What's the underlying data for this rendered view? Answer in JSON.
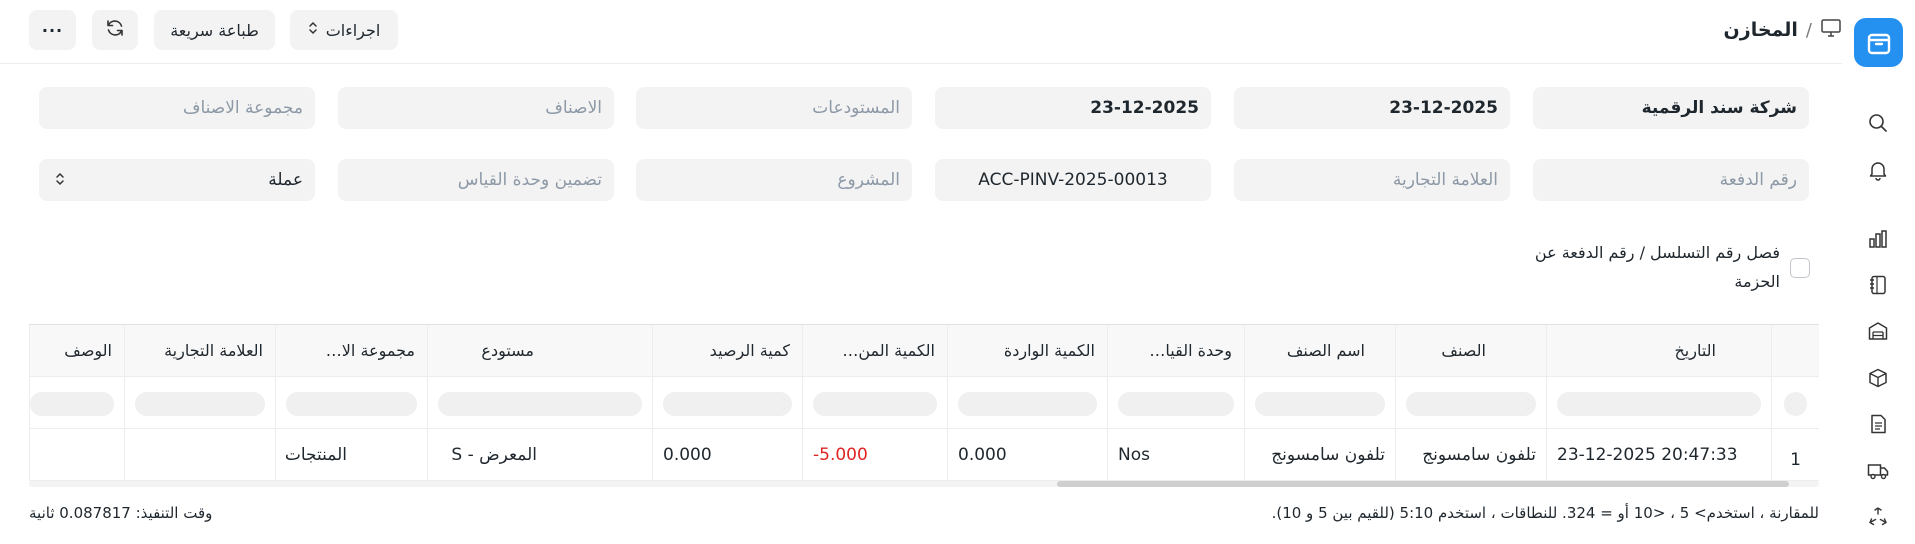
{
  "breadcrumb": {
    "title": "المخازن",
    "separator": "/"
  },
  "toolbar": {
    "actions_label": "اجراءات",
    "quick_print_label": "طباعة سريعة",
    "more_label": "···"
  },
  "filters": {
    "company": "شركة سند الرقمية",
    "from_date": "23-12-2025",
    "to_date": "23-12-2025",
    "warehouses_placeholder": "المستودعات",
    "items_placeholder": "الاصناف",
    "item_group_placeholder": "مجموعة الاصناف",
    "batch_no_placeholder": "رقم الدفعة",
    "brand_placeholder": "العلامة التجارية",
    "voucher_no": "ACC-PINV-2025-00013",
    "project_placeholder": "المشروع",
    "include_uom_placeholder": "تضمين وحدة القياس",
    "currency": "عملة"
  },
  "segregate_checkbox": {
    "label": "فصل رقم التسلسل / رقم الدفعة عن الحزمة",
    "checked": false
  },
  "table": {
    "columns": [
      "التاريخ",
      "الصنف",
      "اسم الصنف",
      "وحدة القيا…",
      "الكمية الواردة",
      "الكمية المن…",
      "كمية الرصيد",
      "مستودع",
      "مجموعة الا…",
      "العلامة التجارية",
      "الوصف"
    ],
    "rows": [
      {
        "index": "1",
        "date": "23-12-2025 20:47:33",
        "item": "تلفون سامسونج",
        "item_name": "تلفون سامسونج",
        "uom": "Nos",
        "in_qty": "0.000",
        "out_qty": "-5.000",
        "balance_qty": "0.000",
        "warehouse": "المعرض - S",
        "item_group": "المنتجات",
        "brand": "",
        "description": ""
      }
    ]
  },
  "footer": {
    "filter_hint": "للمقارنة ، استخدم> 5 ، <10 أو = 324. للنطاقات ، استخدم 5:10 (للقيم بين 5 و 10).",
    "execution_time": "وقت التنفيذ: 0.087817 ثانية"
  },
  "colors": {
    "accent": "#2490ef",
    "negative": "#e02424"
  },
  "rail_icons": [
    "app-logo-icon",
    "search-icon",
    "bell-icon",
    "chart-icon",
    "notebook-icon",
    "warehouse-icon",
    "box-icon",
    "document-icon",
    "truck-icon",
    "recycle-icon"
  ]
}
